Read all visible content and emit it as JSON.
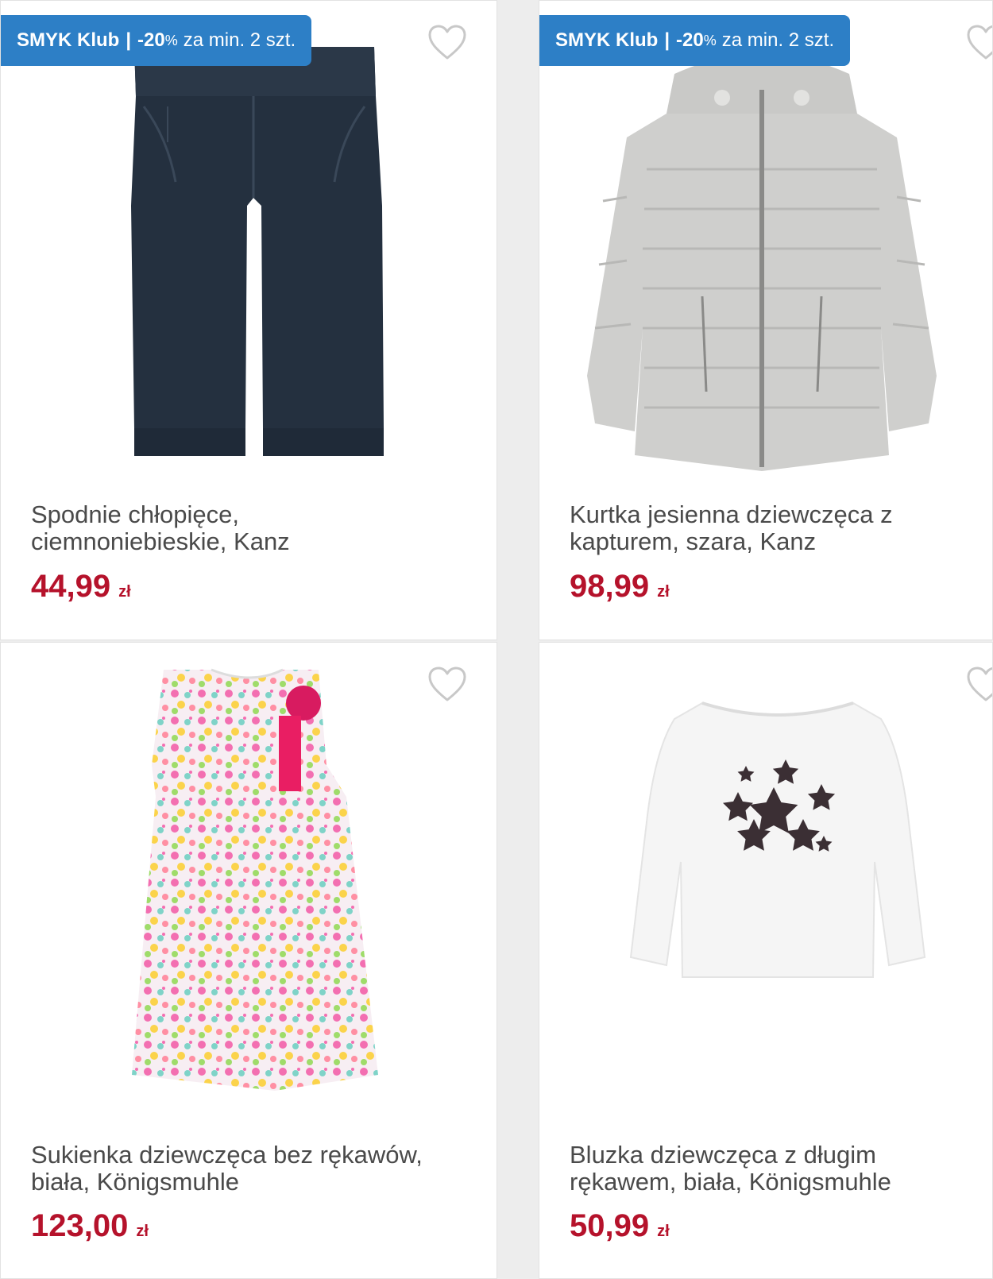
{
  "promo_badge": {
    "club": "SMYK Klub",
    "separator": "|",
    "discount": "-20",
    "percent": "%",
    "terms": "za min. 2 szt."
  },
  "colors": {
    "badge": "#2d7fc6",
    "price": "#b5122b",
    "title": "#4a4a4a",
    "heart": "#c8c8c8"
  },
  "products": [
    {
      "title_line1": "Spodnie chłopięce,",
      "title_line2": "ciemnoniebieskie, Kanz",
      "price": "44,99",
      "currency": "zł",
      "has_promo": true,
      "image": "navy-trousers-image",
      "wishlist_icon": "heart-outline-icon"
    },
    {
      "title_line1": "Kurtka jesienna dziewczęca z",
      "title_line2": "kapturem, szara, Kanz",
      "price": "98,99",
      "currency": "zł",
      "has_promo": true,
      "image": "grey-puffer-jacket-image",
      "wishlist_icon": "heart-outline-icon"
    },
    {
      "title_line1": "Sukienka dziewczęca bez rękawów,",
      "title_line2": "biała, Königsmuhle",
      "price": "123,00",
      "currency": "zł",
      "has_promo": false,
      "image": "hearts-print-dress-image",
      "wishlist_icon": "heart-outline-icon"
    },
    {
      "title_line1": "Bluzka dziewczęca z długim",
      "title_line2": "rękawem, biała, Königsmuhle",
      "price": "50,99",
      "currency": "zł",
      "has_promo": false,
      "image": "white-stars-blouse-image",
      "wishlist_icon": "heart-outline-icon"
    }
  ]
}
